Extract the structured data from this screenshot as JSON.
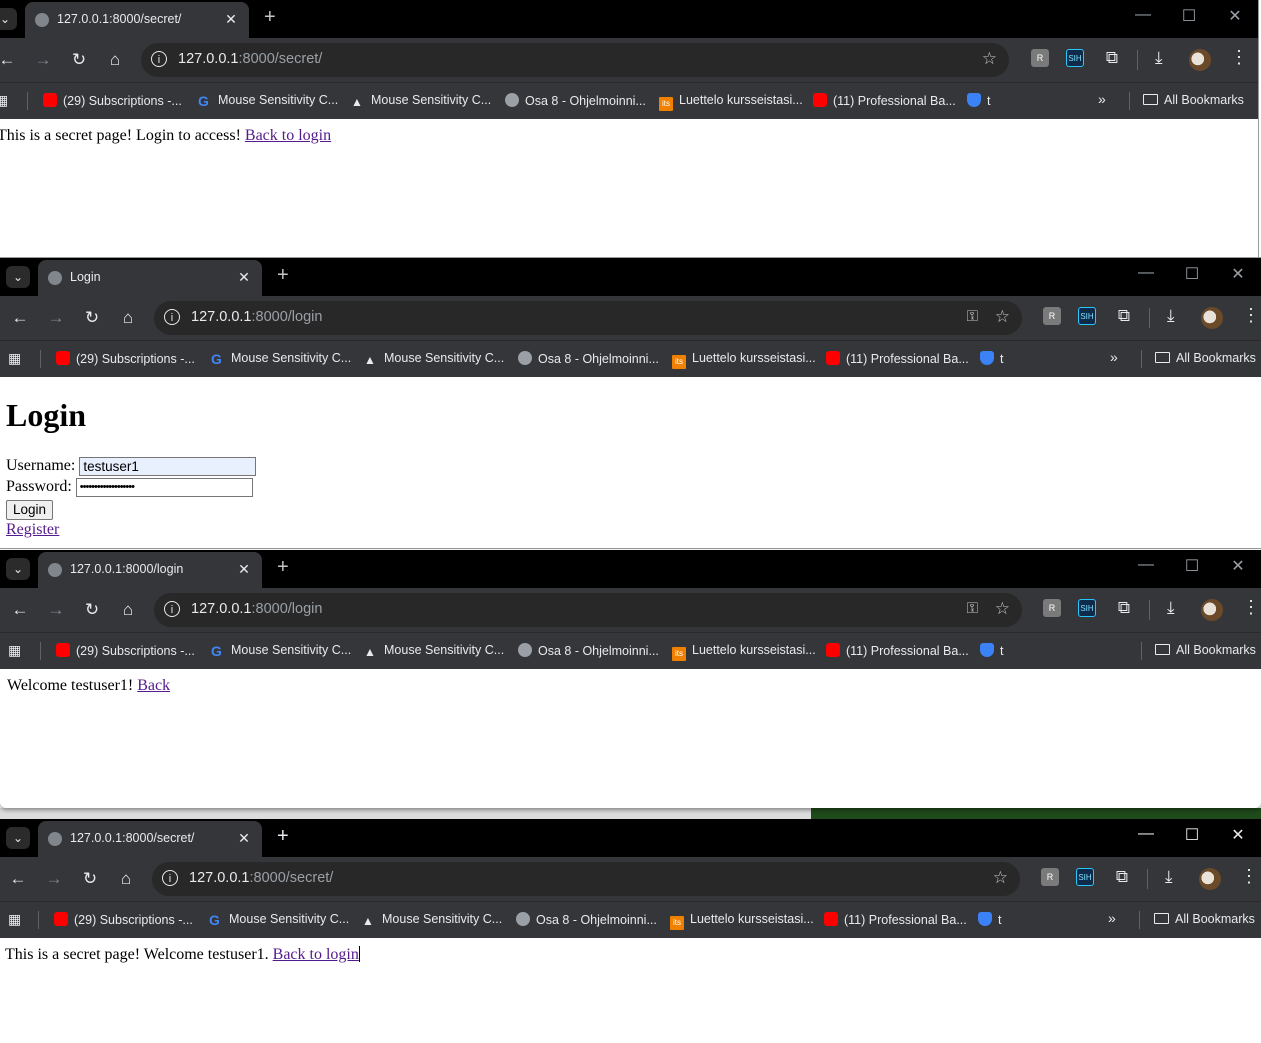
{
  "browser": {
    "bookmarks": [
      {
        "label": "(29) Subscriptions -...",
        "icon": "youtube-icon"
      },
      {
        "label": "Mouse Sensitivity C...",
        "icon": "google-icon"
      },
      {
        "label": "Mouse Sensitivity C...",
        "icon": "triangle-logo-icon"
      },
      {
        "label": "Osa 8 - Ohjelmoinni...",
        "icon": "globe-icon"
      },
      {
        "label": "Luettelo kursseistasi...",
        "icon": "its-icon"
      },
      {
        "label": "(11) Professional Ba...",
        "icon": "youtube-icon"
      },
      {
        "label": "t",
        "icon": "shield-icon"
      }
    ],
    "all_bookmarks": "All Bookmarks",
    "new_tab": "+",
    "more_bookmarks": "»"
  },
  "windows": [
    {
      "tab_title": "127.0.0.1:8000/secret/",
      "url_host": "127.0.0.1",
      "url_rest": ":8000/secret/",
      "content": {
        "text": "This is a secret page! Login to access!",
        "link": "Back to login"
      }
    },
    {
      "tab_title": "Login",
      "url_host": "127.0.0.1",
      "url_rest": ":8000/login",
      "content": {
        "heading": "Login",
        "username_label": "Username:",
        "username_value": "testuser1",
        "password_label": "Password:",
        "password_value": "•••••••••••••••••••",
        "button": "Login",
        "link": "Register"
      }
    },
    {
      "tab_title": "127.0.0.1:8000/login",
      "url_host": "127.0.0.1",
      "url_rest": ":8000/login",
      "content": {
        "text": "Welcome testuser1!",
        "link": "Back"
      }
    },
    {
      "tab_title": "127.0.0.1:8000/secret/",
      "url_host": "127.0.0.1",
      "url_rest": ":8000/secret/",
      "content": {
        "text": "This is a secret page! Welcome testuser1.",
        "link": "Back to login"
      }
    }
  ]
}
